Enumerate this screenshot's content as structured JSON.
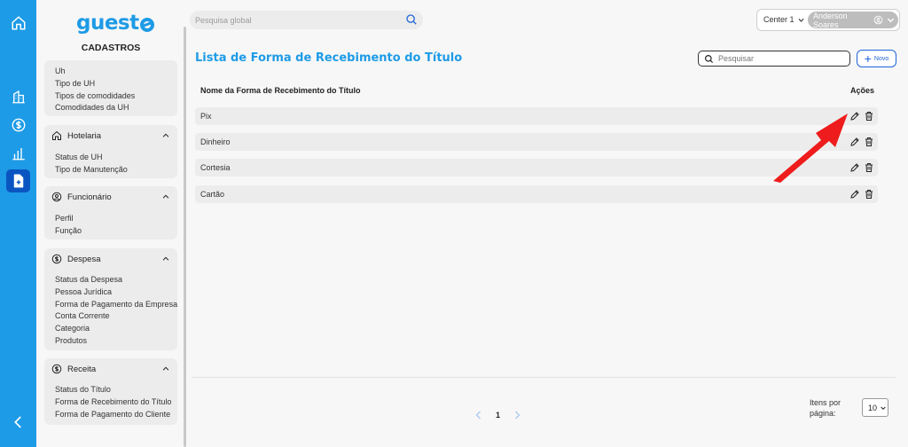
{
  "sidebar": {
    "logo": "guest",
    "section_title": "CADASTROS",
    "uh_items": [
      "Uh",
      "Tipo de UH",
      "Tipos de comodidades",
      "Comodidades da UH"
    ],
    "groups": [
      {
        "label": "Hotelaria",
        "icon": "home-icon",
        "items": [
          "Status de UH",
          "Tipo de Manutenção"
        ]
      },
      {
        "label": "Funcionário",
        "icon": "user-circle-icon",
        "items": [
          "Perfil",
          "Função"
        ]
      },
      {
        "label": "Despesa",
        "icon": "dollar-circle-icon",
        "items": [
          "Status da Despesa",
          "Pessoa Jurídica",
          "Forma de Pagamento da Empresa",
          "Conta Corrente",
          "Categoria",
          "Produtos"
        ]
      },
      {
        "label": "Receita",
        "icon": "dollar-circle-icon",
        "items": [
          "Status do Título",
          "Forma de Recebimento do Título",
          "Forma de Pagamento do Cliente"
        ]
      }
    ]
  },
  "topbar": {
    "global_search_placeholder": "Pesquisa global",
    "center": "Center 1",
    "user": "Anderson Soares"
  },
  "main": {
    "title": "Lista de Forma de Recebimento do Título",
    "search_placeholder": "Pesquisar",
    "new_label": "Novo",
    "col_name": "Nome da Forma de Recebimento do Título",
    "col_actions": "Ações",
    "rows": [
      "Pix",
      "Dinheiro",
      "Cortesia",
      "Cartão"
    ],
    "pagination": {
      "current_page": "1"
    },
    "items_per_page_label": "Itens por página:",
    "items_per_page": "10"
  },
  "colors": {
    "brand": "#1e9be6",
    "rail_active": "#0b55c2",
    "accent_button": "#1e64d8",
    "annotation_arrow": "#ee1c1c"
  }
}
